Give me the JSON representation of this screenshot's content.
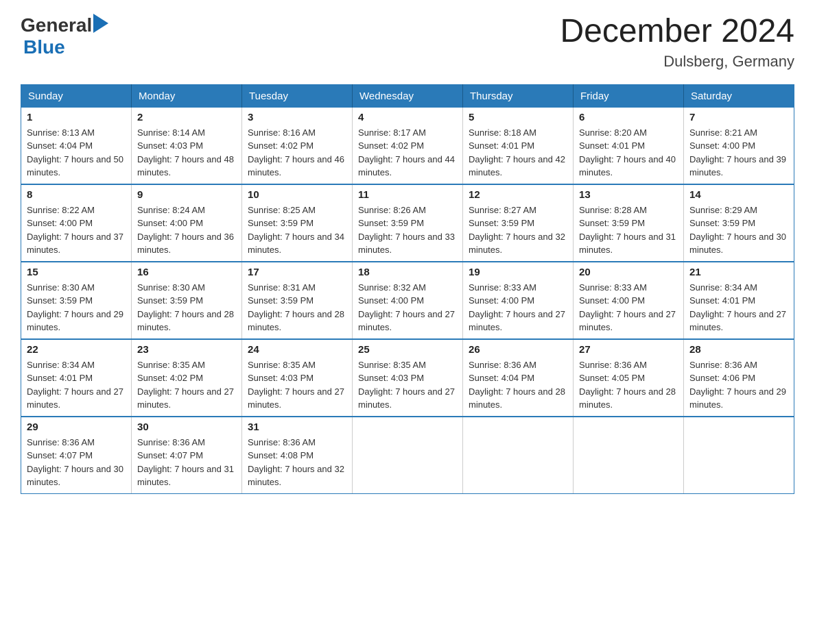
{
  "logo": {
    "general": "General",
    "blue": "Blue",
    "alt": "GeneralBlue logo"
  },
  "title": "December 2024",
  "subtitle": "Dulsberg, Germany",
  "days_of_week": [
    "Sunday",
    "Monday",
    "Tuesday",
    "Wednesday",
    "Thursday",
    "Friday",
    "Saturday"
  ],
  "weeks": [
    [
      {
        "day": "1",
        "sunrise": "8:13 AM",
        "sunset": "4:04 PM",
        "daylight": "7 hours and 50 minutes."
      },
      {
        "day": "2",
        "sunrise": "8:14 AM",
        "sunset": "4:03 PM",
        "daylight": "7 hours and 48 minutes."
      },
      {
        "day": "3",
        "sunrise": "8:16 AM",
        "sunset": "4:02 PM",
        "daylight": "7 hours and 46 minutes."
      },
      {
        "day": "4",
        "sunrise": "8:17 AM",
        "sunset": "4:02 PM",
        "daylight": "7 hours and 44 minutes."
      },
      {
        "day": "5",
        "sunrise": "8:18 AM",
        "sunset": "4:01 PM",
        "daylight": "7 hours and 42 minutes."
      },
      {
        "day": "6",
        "sunrise": "8:20 AM",
        "sunset": "4:01 PM",
        "daylight": "7 hours and 40 minutes."
      },
      {
        "day": "7",
        "sunrise": "8:21 AM",
        "sunset": "4:00 PM",
        "daylight": "7 hours and 39 minutes."
      }
    ],
    [
      {
        "day": "8",
        "sunrise": "8:22 AM",
        "sunset": "4:00 PM",
        "daylight": "7 hours and 37 minutes."
      },
      {
        "day": "9",
        "sunrise": "8:24 AM",
        "sunset": "4:00 PM",
        "daylight": "7 hours and 36 minutes."
      },
      {
        "day": "10",
        "sunrise": "8:25 AM",
        "sunset": "3:59 PM",
        "daylight": "7 hours and 34 minutes."
      },
      {
        "day": "11",
        "sunrise": "8:26 AM",
        "sunset": "3:59 PM",
        "daylight": "7 hours and 33 minutes."
      },
      {
        "day": "12",
        "sunrise": "8:27 AM",
        "sunset": "3:59 PM",
        "daylight": "7 hours and 32 minutes."
      },
      {
        "day": "13",
        "sunrise": "8:28 AM",
        "sunset": "3:59 PM",
        "daylight": "7 hours and 31 minutes."
      },
      {
        "day": "14",
        "sunrise": "8:29 AM",
        "sunset": "3:59 PM",
        "daylight": "7 hours and 30 minutes."
      }
    ],
    [
      {
        "day": "15",
        "sunrise": "8:30 AM",
        "sunset": "3:59 PM",
        "daylight": "7 hours and 29 minutes."
      },
      {
        "day": "16",
        "sunrise": "8:30 AM",
        "sunset": "3:59 PM",
        "daylight": "7 hours and 28 minutes."
      },
      {
        "day": "17",
        "sunrise": "8:31 AM",
        "sunset": "3:59 PM",
        "daylight": "7 hours and 28 minutes."
      },
      {
        "day": "18",
        "sunrise": "8:32 AM",
        "sunset": "4:00 PM",
        "daylight": "7 hours and 27 minutes."
      },
      {
        "day": "19",
        "sunrise": "8:33 AM",
        "sunset": "4:00 PM",
        "daylight": "7 hours and 27 minutes."
      },
      {
        "day": "20",
        "sunrise": "8:33 AM",
        "sunset": "4:00 PM",
        "daylight": "7 hours and 27 minutes."
      },
      {
        "day": "21",
        "sunrise": "8:34 AM",
        "sunset": "4:01 PM",
        "daylight": "7 hours and 27 minutes."
      }
    ],
    [
      {
        "day": "22",
        "sunrise": "8:34 AM",
        "sunset": "4:01 PM",
        "daylight": "7 hours and 27 minutes."
      },
      {
        "day": "23",
        "sunrise": "8:35 AM",
        "sunset": "4:02 PM",
        "daylight": "7 hours and 27 minutes."
      },
      {
        "day": "24",
        "sunrise": "8:35 AM",
        "sunset": "4:03 PM",
        "daylight": "7 hours and 27 minutes."
      },
      {
        "day": "25",
        "sunrise": "8:35 AM",
        "sunset": "4:03 PM",
        "daylight": "7 hours and 27 minutes."
      },
      {
        "day": "26",
        "sunrise": "8:36 AM",
        "sunset": "4:04 PM",
        "daylight": "7 hours and 28 minutes."
      },
      {
        "day": "27",
        "sunrise": "8:36 AM",
        "sunset": "4:05 PM",
        "daylight": "7 hours and 28 minutes."
      },
      {
        "day": "28",
        "sunrise": "8:36 AM",
        "sunset": "4:06 PM",
        "daylight": "7 hours and 29 minutes."
      }
    ],
    [
      {
        "day": "29",
        "sunrise": "8:36 AM",
        "sunset": "4:07 PM",
        "daylight": "7 hours and 30 minutes."
      },
      {
        "day": "30",
        "sunrise": "8:36 AM",
        "sunset": "4:07 PM",
        "daylight": "7 hours and 31 minutes."
      },
      {
        "day": "31",
        "sunrise": "8:36 AM",
        "sunset": "4:08 PM",
        "daylight": "7 hours and 32 minutes."
      },
      null,
      null,
      null,
      null
    ]
  ],
  "labels": {
    "sunrise": "Sunrise:",
    "sunset": "Sunset:",
    "daylight": "Daylight:"
  }
}
